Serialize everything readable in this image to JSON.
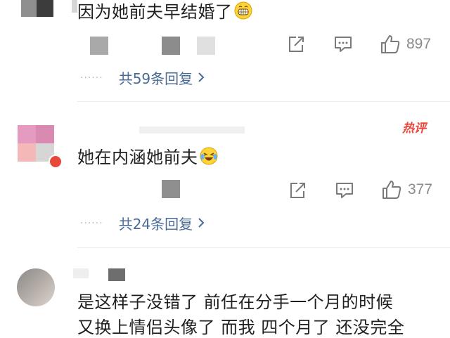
{
  "comments": [
    {
      "text": "因为她前夫早结婚了",
      "emoji": "grinning-face",
      "like_count": "897",
      "replies_label": "共59条回复"
    },
    {
      "text": "她在内涵她前夫",
      "emoji": "laughing-tears-face",
      "hot_badge": "热评",
      "like_count": "377",
      "replies_label": "共24条回复"
    },
    {
      "line1": "是这样子没错了 前任在分手一个月的时候",
      "line2": "又换上情侣头像了 而我 四个月了 还没完全"
    }
  ],
  "icons": {
    "share": "share-icon",
    "comment": "comment-icon",
    "like": "thumbs-up-icon",
    "chevron": "chevron-right-icon"
  },
  "colors": {
    "link": "#4a6a97",
    "hot": "#e8473a",
    "icon": "#7a7a7a"
  }
}
